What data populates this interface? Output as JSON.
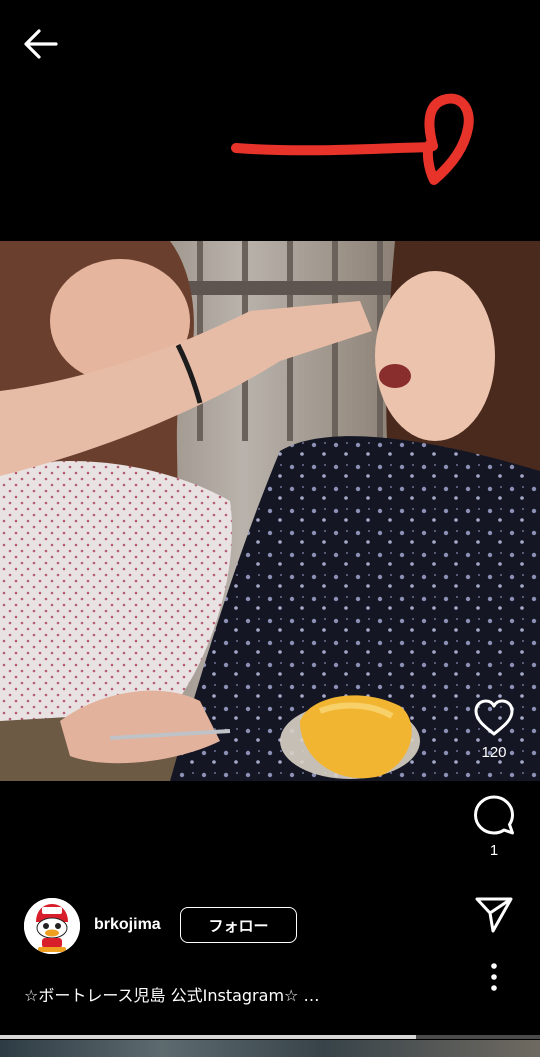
{
  "nav": {
    "back_icon": "arrow-left-icon"
  },
  "video": {
    "description_icon": "video-frame",
    "progress_fraction": 0.77
  },
  "actions": {
    "like": {
      "icon": "heart-icon",
      "count": "120"
    },
    "comment": {
      "icon": "comment-icon",
      "count": "1"
    },
    "share": {
      "icon": "send-icon"
    },
    "more": {
      "icon": "more-vertical-icon"
    }
  },
  "author": {
    "username": "brkojima",
    "follow_label": "フォロー"
  },
  "caption": "☆ボートレース児島 公式Instagram☆ …",
  "colors": {
    "background": "#000000",
    "doodle": "#e8332b",
    "text": "#ffffff"
  }
}
